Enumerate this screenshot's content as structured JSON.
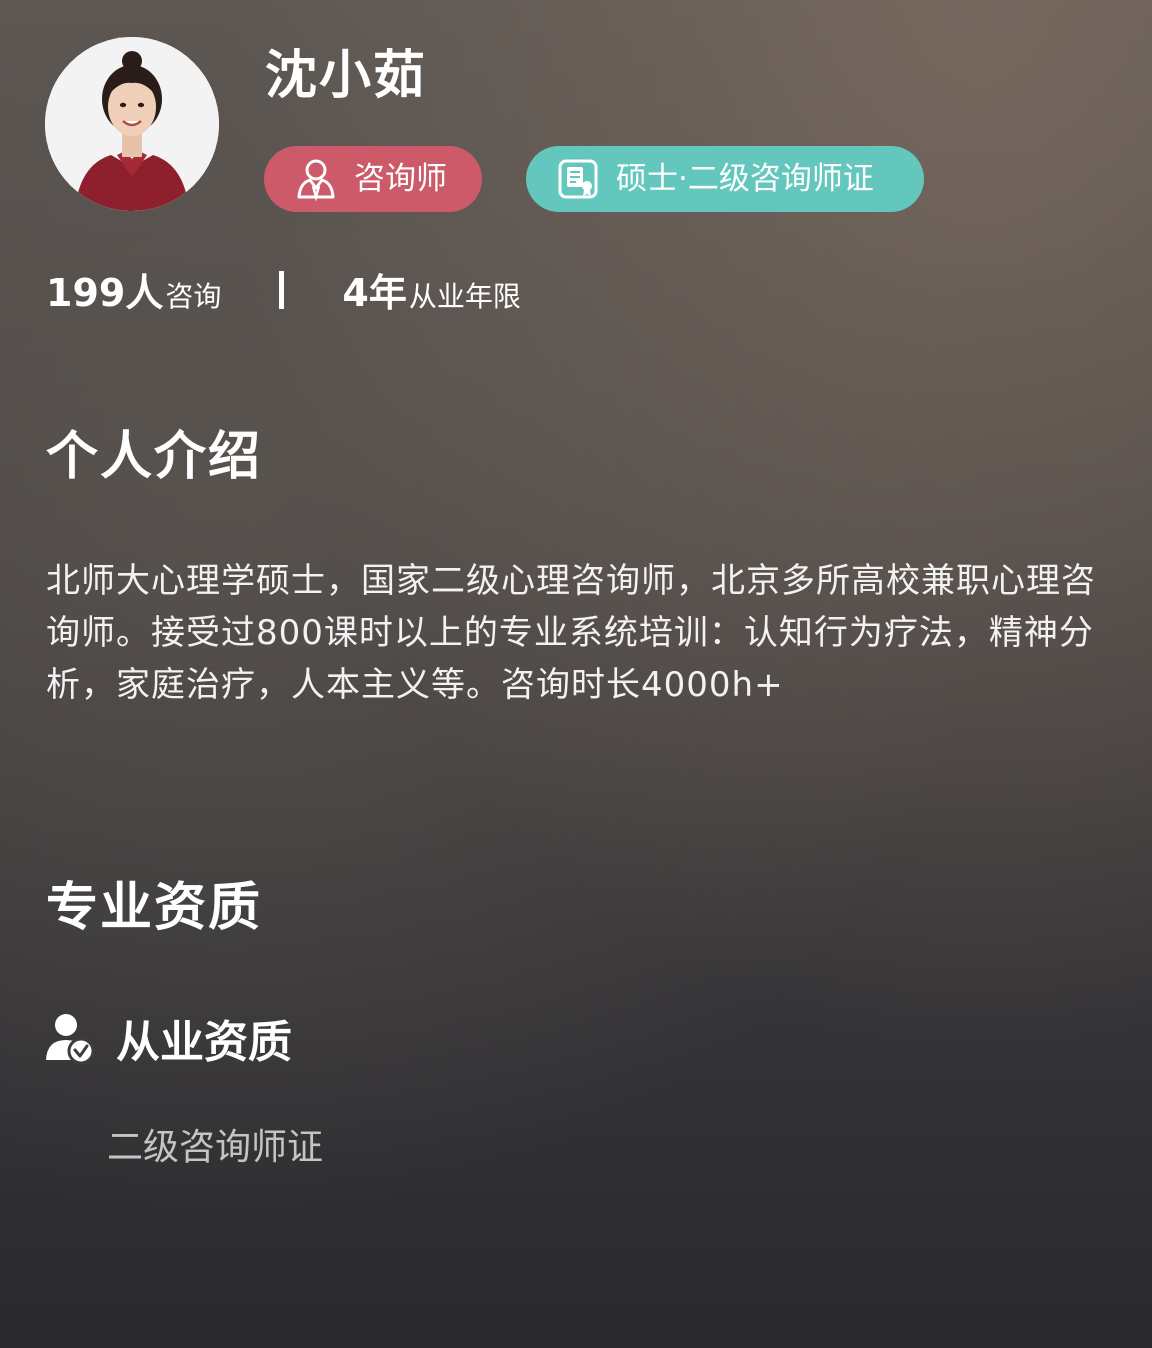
{
  "profile": {
    "name": "沈小茹",
    "avatar_alt": "avatar"
  },
  "badges": {
    "role": {
      "label": "咨询师",
      "icon": "person-icon",
      "color": "#cd5a68"
    },
    "cert": {
      "label": "硕士·二级咨询师证",
      "icon": "certificate-icon",
      "color": "#63c7be"
    }
  },
  "stats": {
    "consult_count": "199",
    "consult_unit": "人",
    "consult_label": "咨询",
    "years": "4",
    "years_unit": "年",
    "years_label": "从业年限"
  },
  "intro": {
    "title": "个人介绍",
    "text": "北师大心理学硕士，国家二级心理咨询师，北京多所高校兼职心理咨询师。接受过800课时以上的专业系统培训：认知行为疗法，精神分析，家庭治疗，人本主义等。咨询时长4000h+"
  },
  "qualifications": {
    "title": "专业资质",
    "subsection_title": "从业资质",
    "subsection_icon": "verified-user-icon",
    "items": [
      "二级咨询师证"
    ]
  }
}
